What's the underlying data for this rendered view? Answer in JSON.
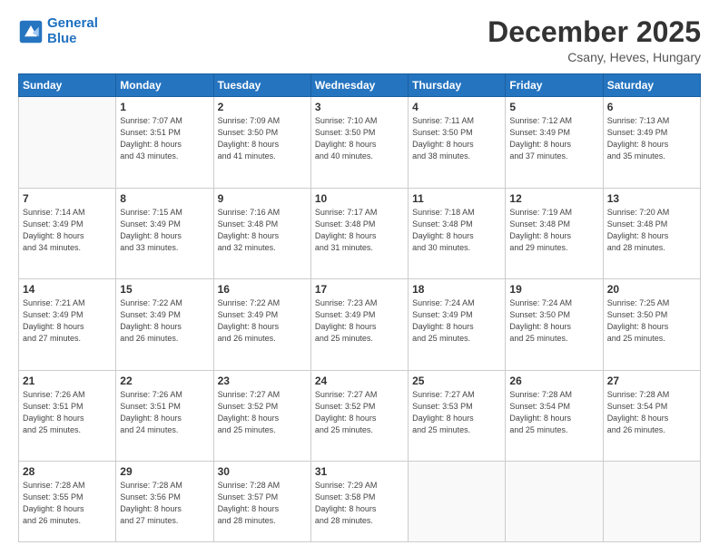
{
  "header": {
    "logo_line1": "General",
    "logo_line2": "Blue",
    "month_title": "December 2025",
    "location": "Csany, Heves, Hungary"
  },
  "weekdays": [
    "Sunday",
    "Monday",
    "Tuesday",
    "Wednesday",
    "Thursday",
    "Friday",
    "Saturday"
  ],
  "weeks": [
    [
      {
        "day": "",
        "sunrise": "",
        "sunset": "",
        "daylight": ""
      },
      {
        "day": "1",
        "sunrise": "Sunrise: 7:07 AM",
        "sunset": "Sunset: 3:51 PM",
        "daylight": "Daylight: 8 hours and 43 minutes."
      },
      {
        "day": "2",
        "sunrise": "Sunrise: 7:09 AM",
        "sunset": "Sunset: 3:50 PM",
        "daylight": "Daylight: 8 hours and 41 minutes."
      },
      {
        "day": "3",
        "sunrise": "Sunrise: 7:10 AM",
        "sunset": "Sunset: 3:50 PM",
        "daylight": "Daylight: 8 hours and 40 minutes."
      },
      {
        "day": "4",
        "sunrise": "Sunrise: 7:11 AM",
        "sunset": "Sunset: 3:50 PM",
        "daylight": "Daylight: 8 hours and 38 minutes."
      },
      {
        "day": "5",
        "sunrise": "Sunrise: 7:12 AM",
        "sunset": "Sunset: 3:49 PM",
        "daylight": "Daylight: 8 hours and 37 minutes."
      },
      {
        "day": "6",
        "sunrise": "Sunrise: 7:13 AM",
        "sunset": "Sunset: 3:49 PM",
        "daylight": "Daylight: 8 hours and 35 minutes."
      }
    ],
    [
      {
        "day": "7",
        "sunrise": "Sunrise: 7:14 AM",
        "sunset": "Sunset: 3:49 PM",
        "daylight": "Daylight: 8 hours and 34 minutes."
      },
      {
        "day": "8",
        "sunrise": "Sunrise: 7:15 AM",
        "sunset": "Sunset: 3:49 PM",
        "daylight": "Daylight: 8 hours and 33 minutes."
      },
      {
        "day": "9",
        "sunrise": "Sunrise: 7:16 AM",
        "sunset": "Sunset: 3:48 PM",
        "daylight": "Daylight: 8 hours and 32 minutes."
      },
      {
        "day": "10",
        "sunrise": "Sunrise: 7:17 AM",
        "sunset": "Sunset: 3:48 PM",
        "daylight": "Daylight: 8 hours and 31 minutes."
      },
      {
        "day": "11",
        "sunrise": "Sunrise: 7:18 AM",
        "sunset": "Sunset: 3:48 PM",
        "daylight": "Daylight: 8 hours and 30 minutes."
      },
      {
        "day": "12",
        "sunrise": "Sunrise: 7:19 AM",
        "sunset": "Sunset: 3:48 PM",
        "daylight": "Daylight: 8 hours and 29 minutes."
      },
      {
        "day": "13",
        "sunrise": "Sunrise: 7:20 AM",
        "sunset": "Sunset: 3:48 PM",
        "daylight": "Daylight: 8 hours and 28 minutes."
      }
    ],
    [
      {
        "day": "14",
        "sunrise": "Sunrise: 7:21 AM",
        "sunset": "Sunset: 3:49 PM",
        "daylight": "Daylight: 8 hours and 27 minutes."
      },
      {
        "day": "15",
        "sunrise": "Sunrise: 7:22 AM",
        "sunset": "Sunset: 3:49 PM",
        "daylight": "Daylight: 8 hours and 26 minutes."
      },
      {
        "day": "16",
        "sunrise": "Sunrise: 7:22 AM",
        "sunset": "Sunset: 3:49 PM",
        "daylight": "Daylight: 8 hours and 26 minutes."
      },
      {
        "day": "17",
        "sunrise": "Sunrise: 7:23 AM",
        "sunset": "Sunset: 3:49 PM",
        "daylight": "Daylight: 8 hours and 25 minutes."
      },
      {
        "day": "18",
        "sunrise": "Sunrise: 7:24 AM",
        "sunset": "Sunset: 3:49 PM",
        "daylight": "Daylight: 8 hours and 25 minutes."
      },
      {
        "day": "19",
        "sunrise": "Sunrise: 7:24 AM",
        "sunset": "Sunset: 3:50 PM",
        "daylight": "Daylight: 8 hours and 25 minutes."
      },
      {
        "day": "20",
        "sunrise": "Sunrise: 7:25 AM",
        "sunset": "Sunset: 3:50 PM",
        "daylight": "Daylight: 8 hours and 25 minutes."
      }
    ],
    [
      {
        "day": "21",
        "sunrise": "Sunrise: 7:26 AM",
        "sunset": "Sunset: 3:51 PM",
        "daylight": "Daylight: 8 hours and 25 minutes."
      },
      {
        "day": "22",
        "sunrise": "Sunrise: 7:26 AM",
        "sunset": "Sunset: 3:51 PM",
        "daylight": "Daylight: 8 hours and 24 minutes."
      },
      {
        "day": "23",
        "sunrise": "Sunrise: 7:27 AM",
        "sunset": "Sunset: 3:52 PM",
        "daylight": "Daylight: 8 hours and 25 minutes."
      },
      {
        "day": "24",
        "sunrise": "Sunrise: 7:27 AM",
        "sunset": "Sunset: 3:52 PM",
        "daylight": "Daylight: 8 hours and 25 minutes."
      },
      {
        "day": "25",
        "sunrise": "Sunrise: 7:27 AM",
        "sunset": "Sunset: 3:53 PM",
        "daylight": "Daylight: 8 hours and 25 minutes."
      },
      {
        "day": "26",
        "sunrise": "Sunrise: 7:28 AM",
        "sunset": "Sunset: 3:54 PM",
        "daylight": "Daylight: 8 hours and 25 minutes."
      },
      {
        "day": "27",
        "sunrise": "Sunrise: 7:28 AM",
        "sunset": "Sunset: 3:54 PM",
        "daylight": "Daylight: 8 hours and 26 minutes."
      }
    ],
    [
      {
        "day": "28",
        "sunrise": "Sunrise: 7:28 AM",
        "sunset": "Sunset: 3:55 PM",
        "daylight": "Daylight: 8 hours and 26 minutes."
      },
      {
        "day": "29",
        "sunrise": "Sunrise: 7:28 AM",
        "sunset": "Sunset: 3:56 PM",
        "daylight": "Daylight: 8 hours and 27 minutes."
      },
      {
        "day": "30",
        "sunrise": "Sunrise: 7:28 AM",
        "sunset": "Sunset: 3:57 PM",
        "daylight": "Daylight: 8 hours and 28 minutes."
      },
      {
        "day": "31",
        "sunrise": "Sunrise: 7:29 AM",
        "sunset": "Sunset: 3:58 PM",
        "daylight": "Daylight: 8 hours and 28 minutes."
      },
      {
        "day": "",
        "sunrise": "",
        "sunset": "",
        "daylight": ""
      },
      {
        "day": "",
        "sunrise": "",
        "sunset": "",
        "daylight": ""
      },
      {
        "day": "",
        "sunrise": "",
        "sunset": "",
        "daylight": ""
      }
    ]
  ]
}
